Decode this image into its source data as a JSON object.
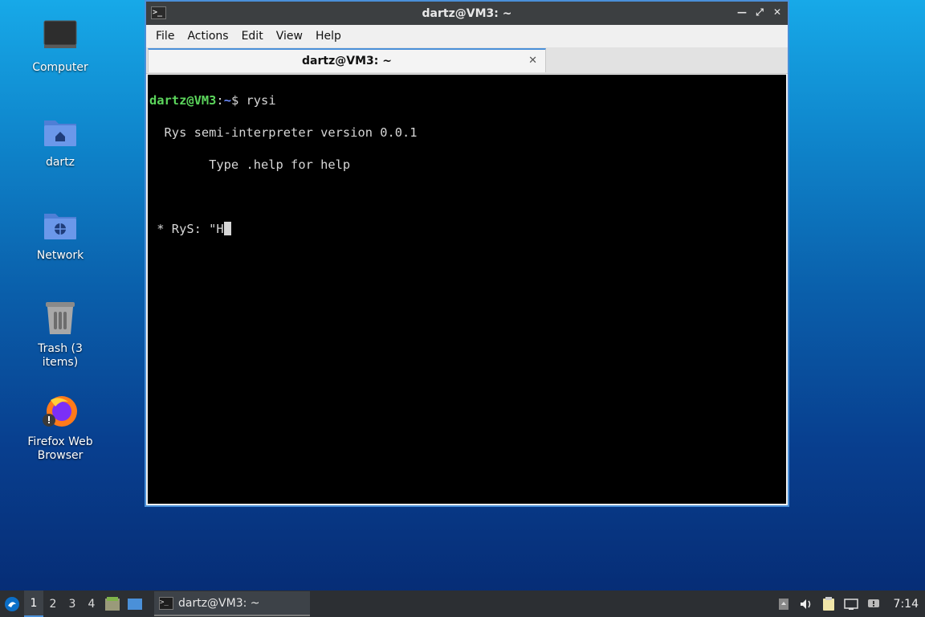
{
  "desktop": {
    "icons": [
      {
        "label": "Computer"
      },
      {
        "label": "dartz"
      },
      {
        "label": "Network"
      },
      {
        "label": "Trash (3 items)"
      },
      {
        "label": "Firefox Web Browser"
      }
    ]
  },
  "window": {
    "title": "dartz@VM3: ~",
    "menu": [
      "File",
      "Actions",
      "Edit",
      "View",
      "Help"
    ],
    "tab_title": "dartz@VM3: ~"
  },
  "terminal": {
    "prompt_user": "dartz@VM3",
    "prompt_sep": ":",
    "prompt_path": "~",
    "prompt_symbol": "$ ",
    "command": "rysi",
    "lines": [
      "  Rys semi-interpreter version 0.0.1",
      "        Type .help for help",
      "",
      " * RyS: \"H"
    ]
  },
  "taskbar": {
    "workspaces": [
      "1",
      "2",
      "3",
      "4"
    ],
    "active_workspace": "1",
    "task_label": "dartz@VM3: ~",
    "clock": "7:14"
  },
  "colors": {
    "accent": "#4a90d9",
    "prompt_user": "#5cd65c",
    "prompt_path": "#6d8cff",
    "terminal_bg": "#000000"
  }
}
